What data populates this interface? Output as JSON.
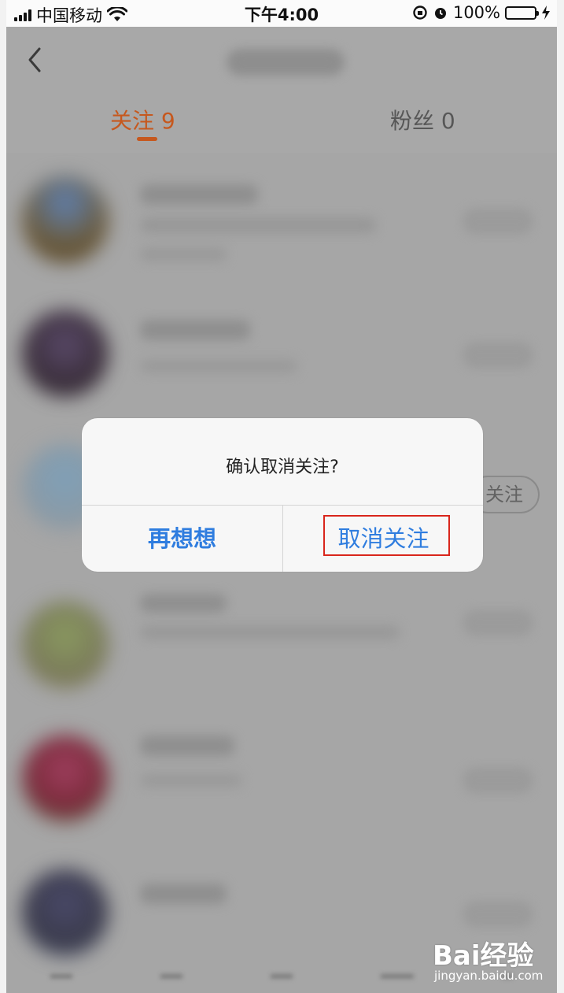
{
  "status_bar": {
    "carrier": "中国移动",
    "time": "下午4:00",
    "battery_percent": "100%",
    "icons": [
      "signal-icon",
      "wifi-icon",
      "rotation-lock-icon",
      "alarm-icon",
      "battery-icon",
      "charging-icon"
    ]
  },
  "header": {
    "back_icon": "chevron-left-icon",
    "tabs": [
      {
        "label": "关注 9",
        "active": true
      },
      {
        "label": "粉丝 0",
        "active": false
      }
    ]
  },
  "behind_button_text": "关注",
  "dialog": {
    "message": "确认取消关注?",
    "cancel_label": "再想想",
    "confirm_label": "取消关注"
  },
  "colors": {
    "accent": "#c6581e",
    "dialog_button": "#2f7ddf",
    "highlight": "#d9261c",
    "battery": "#35c24a"
  },
  "watermark": {
    "logo": "Bai经验",
    "url": "jingyan.baidu.com"
  }
}
